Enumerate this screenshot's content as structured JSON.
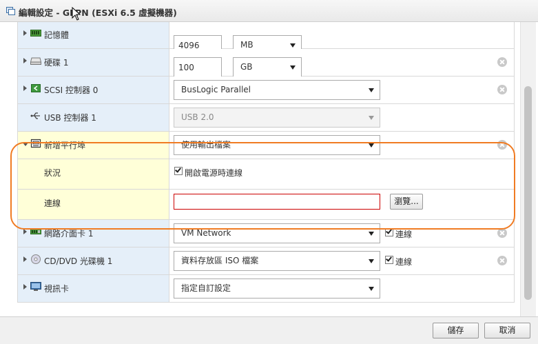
{
  "window": {
    "title": "編輯設定 - GLPN (ESXi 6.5 虛擬機器)"
  },
  "rows": {
    "memory": {
      "label": "記憶體",
      "value": "4096",
      "unit": "MB"
    },
    "disk": {
      "label": "硬碟 1",
      "value": "100",
      "unit": "GB"
    },
    "scsi": {
      "label": "SCSI 控制器 0",
      "value": "BusLogic Parallel"
    },
    "usb": {
      "label": "USB 控制器 1",
      "value": "USB 2.0"
    },
    "serial": {
      "label": "新增平行埠",
      "value": "使用輸出檔案",
      "status_label": "狀況",
      "status_checkbox_label": "開啟電源時連線",
      "status_checked": true,
      "connection_label": "連線",
      "connection_value": "",
      "browse_label": "瀏覽..."
    },
    "nic": {
      "label": "網路介面卡 1",
      "value": "VM Network",
      "connect_label": "連線",
      "connect_checked": true
    },
    "cd": {
      "label": "CD/DVD 光碟機 1",
      "value": "資料存放區 ISO 檔案",
      "connect_label": "連線",
      "connect_checked": true
    },
    "video": {
      "label": "視訊卡",
      "value": "指定自訂設定"
    }
  },
  "footer": {
    "save_label": "儲存",
    "cancel_label": "取消"
  },
  "colors": {
    "highlight_outline": "#f07b22",
    "left_cell": "#e5eff9",
    "highlight_cell": "#ffffd8",
    "error_border": "#cc0000"
  }
}
